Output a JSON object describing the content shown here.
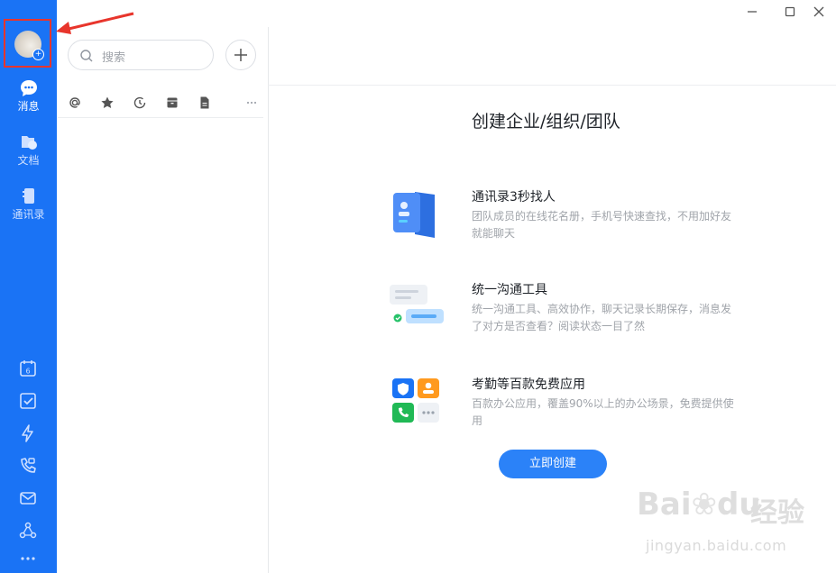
{
  "sidebar": {
    "nav": [
      {
        "label": "消息",
        "icon": "message-icon",
        "active": true
      },
      {
        "label": "文档",
        "icon": "docs-icon",
        "active": false
      },
      {
        "label": "通讯录",
        "icon": "contacts-icon",
        "active": false
      }
    ],
    "tools": [
      "calendar-icon",
      "todo-icon",
      "lightning-icon",
      "phone-video-icon",
      "mail-icon",
      "org-icon",
      "more-icon"
    ],
    "calendar_day": "6"
  },
  "search": {
    "placeholder": "搜索"
  },
  "filters": [
    "at-icon",
    "star-icon",
    "recent-icon",
    "archive-icon",
    "file-icon",
    "more-icon"
  ],
  "main": {
    "title": "创建企业/组织/团队",
    "features": [
      {
        "title": "通讯录3秒找人",
        "desc": "团队成员的在线花名册，手机号快速查找，不用加好友就能聊天"
      },
      {
        "title": "统一沟通工具",
        "desc": "统一沟通工具、高效协作，聊天记录长期保存，消息发了对方是否查看？阅读状态一目了然"
      },
      {
        "title": "考勤等百款免费应用",
        "desc": "百款办公应用，覆盖90%以上的办公场景，免费提供使用"
      }
    ],
    "create_button": "立即创建"
  },
  "watermark": {
    "brand": "Bai",
    "brand2": "du",
    "cn": "经验",
    "url": "jingyan.baidu.com"
  },
  "colors": {
    "sidebar": "#1a73f5",
    "accent": "#2b82f8",
    "highlight": "#e8352c"
  }
}
